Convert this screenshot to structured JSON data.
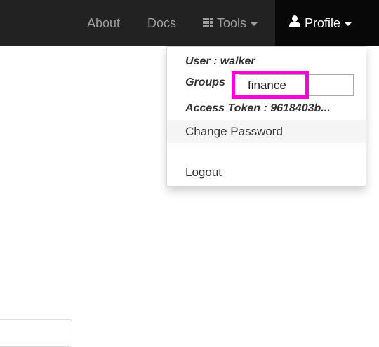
{
  "navbar": {
    "items": [
      {
        "label": "About",
        "icon": null
      },
      {
        "label": "Docs",
        "icon": null
      },
      {
        "label": "Tools",
        "icon": "grid-icon",
        "dropdown": true
      },
      {
        "label": "Profile",
        "icon": "user-icon",
        "dropdown": true,
        "active": true
      }
    ]
  },
  "profile_menu": {
    "user_text": "User : walker",
    "groups_label": "Groups",
    "groups_value": "finance",
    "token_text": "Access Token : 9618403b...",
    "change_password_label": "Change Password",
    "logout_label": "Logout"
  },
  "colors": {
    "navbar_bg": "#222222",
    "navbar_active_bg": "#080808",
    "navbar_text": "#9d9d9d",
    "highlight": "#ff00d8"
  }
}
